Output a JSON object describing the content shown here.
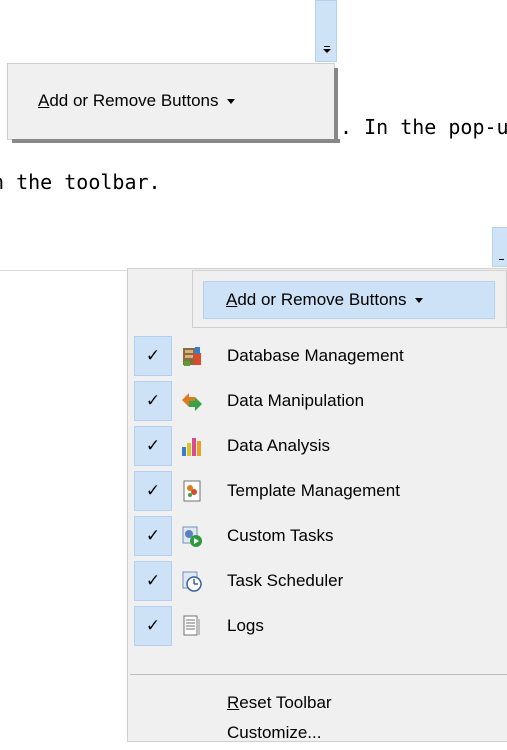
{
  "top_button": {
    "prefix": "A",
    "rest": "dd or Remove Buttons"
  },
  "body_text": {
    "line1": ". In the pop-u",
    "line2": "n the toolbar."
  },
  "menu": {
    "header": {
      "prefix": "A",
      "rest": "dd or Remove Buttons"
    },
    "check_glyph": "✓",
    "items": [
      {
        "label": "Database Management",
        "icon": "database-management-icon",
        "checked": true
      },
      {
        "label": "Data Manipulation",
        "icon": "data-manipulation-icon",
        "checked": true
      },
      {
        "label": "Data Analysis",
        "icon": "data-analysis-icon",
        "checked": true
      },
      {
        "label": "Template Management",
        "icon": "template-management-icon",
        "checked": true
      },
      {
        "label": "Custom Tasks",
        "icon": "custom-tasks-icon",
        "checked": true
      },
      {
        "label": "Task Scheduler",
        "icon": "task-scheduler-icon",
        "checked": true
      },
      {
        "label": "Logs",
        "icon": "logs-icon",
        "checked": true
      }
    ],
    "reset": {
      "prefix": "R",
      "rest": "eset Toolbar"
    },
    "customize": "Customize..."
  },
  "colors": {
    "highlight": "#cde2f6",
    "highlight_border": "#b4d0ee",
    "menu_bg": "#f0f0f0"
  }
}
